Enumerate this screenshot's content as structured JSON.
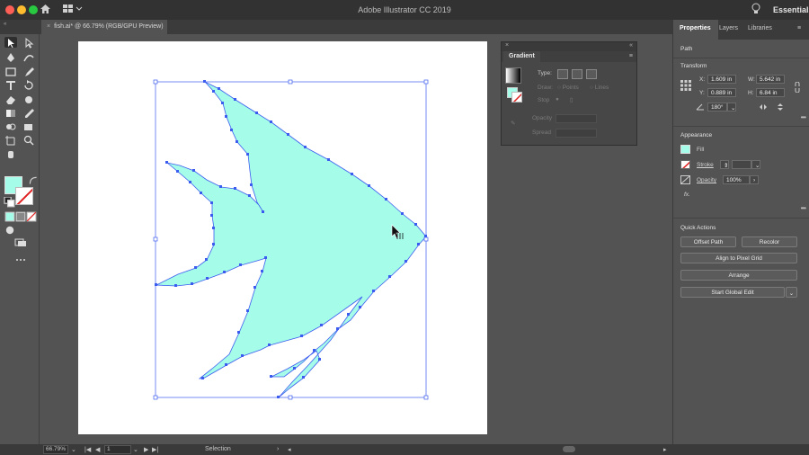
{
  "titlebar": {
    "app_title": "Adobe Illustrator CC 2019",
    "workspace": "Essentials"
  },
  "document": {
    "tab_label": "fish.ai* @ 66.79% (RGB/GPU Preview)",
    "close_glyph": "×"
  },
  "colors": {
    "fill": "#a4fce9",
    "selection": "#3c5cf0",
    "artboard": "#ffffff",
    "ui_background": "#535353"
  },
  "gradient_panel": {
    "title": "Gradient",
    "type_label": "Type:",
    "draw_label": "Draw:",
    "points_label": "Points",
    "lines_label": "Lines",
    "stop_label": "Stop",
    "opacity_label": "Opacity",
    "spread_label": "Spread"
  },
  "properties_panel": {
    "tabs": [
      "Properties",
      "Layers",
      "Libraries"
    ],
    "object_type": "Path",
    "transform": {
      "heading": "Transform",
      "x_label": "X:",
      "x_value": "1.609 in",
      "y_label": "Y:",
      "y_value": "0.889 in",
      "w_label": "W:",
      "w_value": "5.642 in",
      "h_label": "H:",
      "h_value": "6.84 in",
      "angle_value": "180°"
    },
    "appearance": {
      "heading": "Appearance",
      "fill_label": "Fill",
      "stroke_label": "Stroke",
      "opacity_label": "Opacity",
      "opacity_value": "100%",
      "fx_label": "fx."
    },
    "quick_actions": {
      "heading": "Quick Actions",
      "offset_path": "Offset Path",
      "recolor": "Recolor",
      "align_pixel_grid": "Align to Pixel Grid",
      "arrange": "Arrange",
      "start_global_edit": "Start Global Edit"
    }
  },
  "statusbar": {
    "zoom": "66.79%",
    "artboard_number": "1",
    "tool_name": "Selection"
  }
}
